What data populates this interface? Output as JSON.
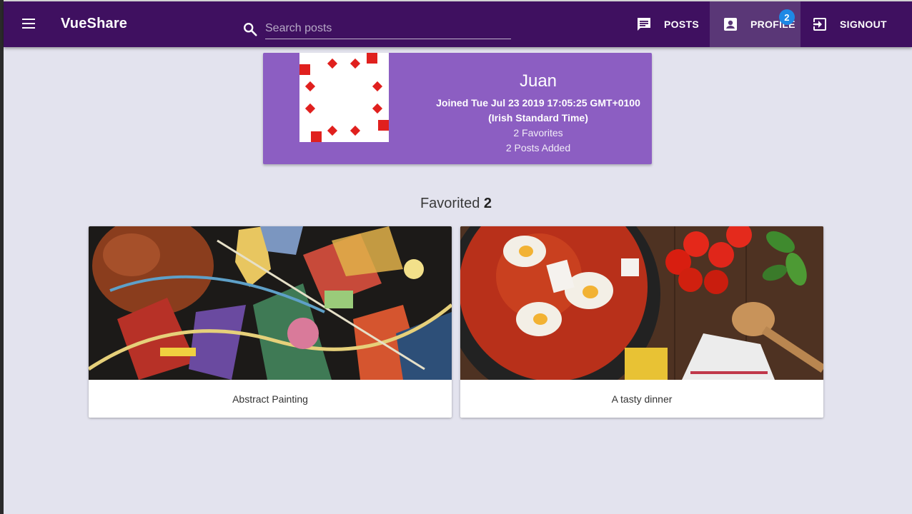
{
  "app": {
    "title": "VueShare"
  },
  "search": {
    "placeholder": "Search posts"
  },
  "nav": {
    "posts_label": "POSTS",
    "profile_label": "PROFILE",
    "profile_badge": "2",
    "signout_label": "SIGNOUT"
  },
  "profile": {
    "name": "Juan",
    "joined_line1": "Joined Tue Jul 23 2019 17:05:25 GMT+0100",
    "joined_line2": "(Irish Standard Time)",
    "favorites": "2 Favorites",
    "posts_added": "2 Posts Added"
  },
  "favorites_section": {
    "label": "Favorited",
    "count": "2"
  },
  "posts": [
    {
      "title": "Abstract Painting"
    },
    {
      "title": "A tasty dinner"
    }
  ],
  "colors": {
    "toolbar": "#3f1060",
    "active_nav": "#5a3777",
    "profile_card": "#8c5ec2",
    "badge": "#1e88e5",
    "background": "#e3e3ee"
  }
}
